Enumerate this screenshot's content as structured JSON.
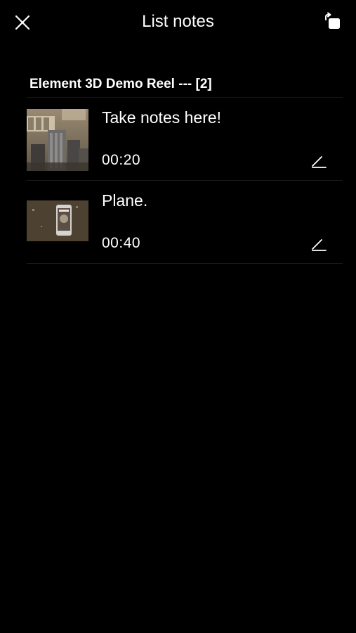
{
  "header": {
    "title": "List notes",
    "close_icon": "close-icon",
    "rotate_icon": "rotate-screen-icon"
  },
  "video": {
    "title": "Element 3D Demo Reel --- [2]"
  },
  "notes": [
    {
      "text": "Take notes here!",
      "time": "00:20",
      "thumbnail": "city-skyline-thumbnail",
      "edit_icon": "pencil-icon"
    },
    {
      "text": "Plane.",
      "time": "00:40",
      "thumbnail": "phone-render-thumbnail",
      "edit_icon": "pencil-icon"
    }
  ],
  "colors": {
    "background": "#000000",
    "text": "#ffffff",
    "divider": "#1c1c1c"
  }
}
